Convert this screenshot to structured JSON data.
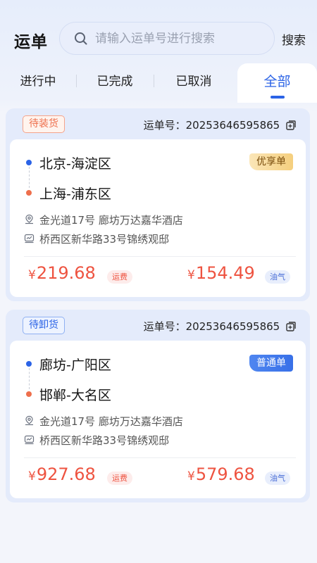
{
  "header": {
    "title": "运单",
    "search_placeholder": "请输入运单号进行搜索",
    "search_button": "搜索"
  },
  "tabs": [
    {
      "label": "进行中"
    },
    {
      "label": "已完成"
    },
    {
      "label": "已取消"
    },
    {
      "label": "全部",
      "active": true
    }
  ],
  "orders": [
    {
      "status": "待装货",
      "order_label": "运单号：",
      "order_no": "20253646595865",
      "from": "北京-海淀区",
      "to": "上海-浦东区",
      "badge": "优享单",
      "address_load": "金光道17号 廊坊万达嘉华酒店",
      "address_unload": "桥西区新华路33号锦绣观邸",
      "freight": {
        "currency": "¥",
        "amount": "219.68",
        "tag": "运费"
      },
      "fuel": {
        "currency": "¥",
        "amount": "154.49",
        "tag": "油气"
      }
    },
    {
      "status": "待卸货",
      "order_label": "运单号：",
      "order_no": "20253646595865",
      "from": "廊坊-广阳区",
      "to": "邯郸-大名区",
      "badge": "普通单",
      "address_load": "金光道17号 廊坊万达嘉华酒店",
      "address_unload": "桥西区新华路33号锦绣观邸",
      "freight": {
        "currency": "¥",
        "amount": "927.68",
        "tag": "运费"
      },
      "fuel": {
        "currency": "¥",
        "amount": "579.68",
        "tag": "油气"
      }
    }
  ],
  "colors": {
    "accent": "#2b63e6",
    "price": "#ee5340",
    "status_loading": "#ee6f4c"
  },
  "icons": [
    "search-icon",
    "copy-icon",
    "location-pin-icon",
    "truck-icon"
  ]
}
